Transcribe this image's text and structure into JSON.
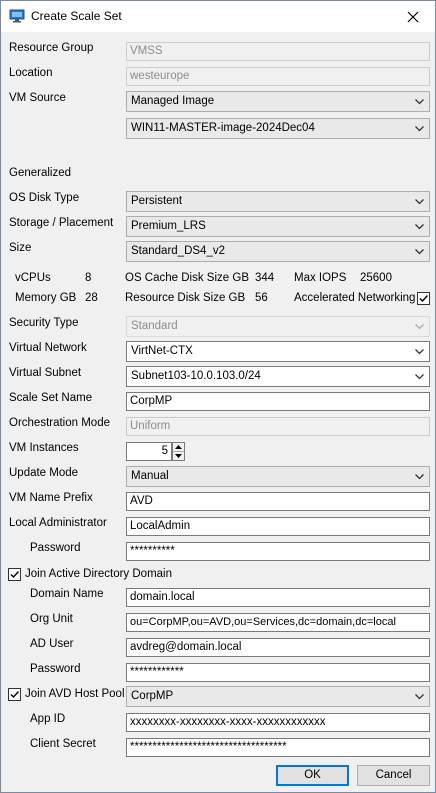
{
  "window": {
    "title": "Create Scale Set"
  },
  "fields": {
    "resource_group": {
      "label": "Resource Group",
      "value": "VMSS"
    },
    "location": {
      "label": "Location",
      "value": "westeurope"
    },
    "vm_source": {
      "label": "VM Source",
      "value": "Managed Image",
      "image": "WIN11-MASTER-image-2024Dec04"
    },
    "generalized": {
      "label": "Generalized"
    },
    "os_disk_type": {
      "label": "OS Disk Type",
      "value": "Persistent"
    },
    "storage": {
      "label": "Storage / Placement",
      "value": "Premium_LRS"
    },
    "size": {
      "label": "Size",
      "value": "Standard_DS4_v2"
    },
    "specs": {
      "vcpus_label": "vCPUs",
      "vcpus": "8",
      "os_cache_label": "OS Cache Disk Size GB",
      "os_cache": "344",
      "max_iops_label": "Max IOPS",
      "max_iops": "25600",
      "memory_label": "Memory GB",
      "memory": "28",
      "resource_disk_label": "Resource Disk Size GB",
      "resource_disk": "56",
      "accel_label": "Accelerated Networking",
      "accel_checked": true
    },
    "security_type": {
      "label": "Security Type",
      "value": "Standard"
    },
    "virtual_network": {
      "label": "Virtual Network",
      "value": "VirtNet-CTX"
    },
    "virtual_subnet": {
      "label": "Virtual Subnet",
      "value": "Subnet103-10.0.103.0/24"
    },
    "scale_set_name": {
      "label": "Scale Set  Name",
      "value": "CorpMP"
    },
    "orchestration_mode": {
      "label": "Orchestration Mode",
      "value": "Uniform"
    },
    "vm_instances": {
      "label": "VM Instances",
      "value": "5"
    },
    "update_mode": {
      "label": "Update Mode",
      "value": "Manual"
    },
    "vm_name_prefix": {
      "label": "VM Name Prefix",
      "value": "AVD"
    },
    "local_admin": {
      "label": "Local Administrator",
      "value": "LocalAdmin"
    },
    "local_password": {
      "label": "Password",
      "value": "**********"
    },
    "join_ad": {
      "label": "Join Active Directory Domain",
      "checked": true
    },
    "domain_name": {
      "label": "Domain Name",
      "value": "domain.local"
    },
    "org_unit": {
      "label": "Org Unit",
      "value": "ou=CorpMP,ou=AVD,ou=Services,dc=domain,dc=local"
    },
    "ad_user": {
      "label": "AD User",
      "value": "avdreg@domain.local"
    },
    "ad_password": {
      "label": "Password",
      "value": "************"
    },
    "join_pool": {
      "label": "Join AVD Host Pool",
      "checked": true,
      "value": "CorpMP"
    },
    "app_id": {
      "label": "App ID",
      "value": "xxxxxxxx-xxxxxxxx-xxxx-xxxxxxxxxxxx"
    },
    "client_secret": {
      "label": "Client Secret",
      "value": "***********************************"
    }
  },
  "buttons": {
    "ok": "OK",
    "cancel": "Cancel"
  },
  "icons": {
    "app": "monitor-icon",
    "close": "close-icon",
    "dropdown": "chevron-down-icon"
  }
}
